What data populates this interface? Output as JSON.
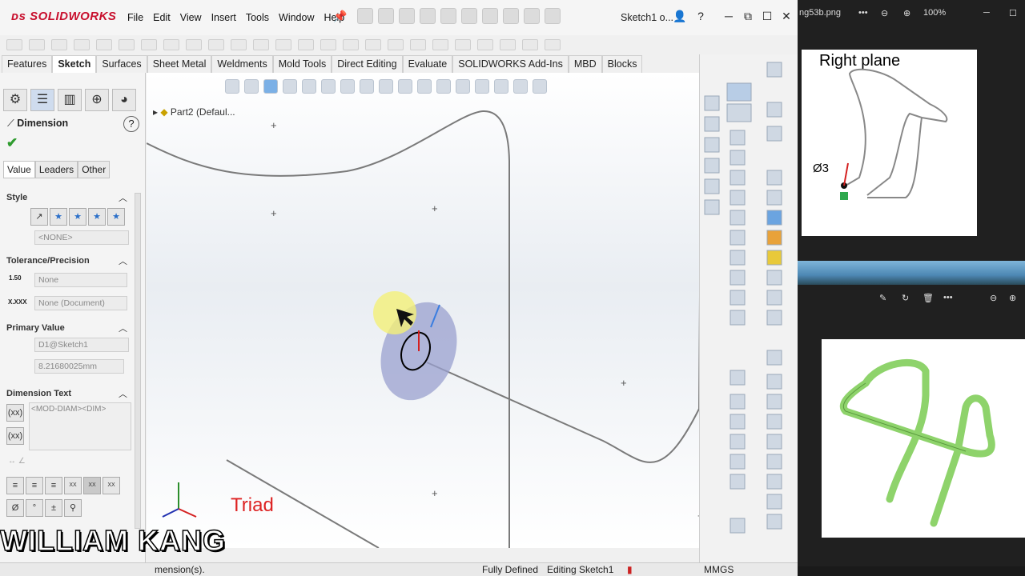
{
  "app": {
    "logo_text": "SOLIDWORKS",
    "menu": [
      "File",
      "Edit",
      "View",
      "Insert",
      "Tools",
      "Window",
      "Help"
    ],
    "doc_title": "Sketch1 o...",
    "help_glyph": "?"
  },
  "command_tabs": [
    "Features",
    "Sketch",
    "Surfaces",
    "Sheet Metal",
    "Weldments",
    "Mold Tools",
    "Direct Editing",
    "Evaluate",
    "SOLIDWORKS Add-Ins",
    "MBD",
    "Blocks"
  ],
  "active_tab": "Sketch",
  "property_manager": {
    "title": "Dimension",
    "help": "?",
    "subtabs": [
      "Value",
      "Leaders",
      "Other"
    ],
    "style": {
      "header": "Style",
      "select_value": "<NONE>"
    },
    "tolerance": {
      "header": "Tolerance/Precision",
      "tolerance_type": "None",
      "precision": "None (Document)",
      "tol_icon": "1.50",
      "prec_icon": "X.XXX"
    },
    "primary_value": {
      "header": "Primary Value",
      "reference": "D1@Sketch1",
      "value": "8.21680025mm"
    },
    "dimension_text": {
      "header": "Dimension Text",
      "text": "<MOD-DIAM><DIM>",
      "icon_label": "(xx)"
    },
    "symbols": [
      "Ø",
      "°",
      "±",
      "⚲"
    ]
  },
  "viewport": {
    "tree_item": "Part2  (Defaul...",
    "triad_label": "Triad"
  },
  "status_bar": {
    "left": "mension(s).",
    "fully_defined": "Fully Defined",
    "editing": "Editing Sketch1",
    "units": "MMGS"
  },
  "watermark": "WILLIAM KANG",
  "photos": {
    "file_name": "ng53b.png",
    "zoom": "100%",
    "image1_label": "Right plane",
    "image1_dim": "Ø3"
  },
  "colors": {
    "sw_red": "#c8102e",
    "tube_green": "#8ed36b",
    "sketch_gray": "#7a7a7a"
  }
}
